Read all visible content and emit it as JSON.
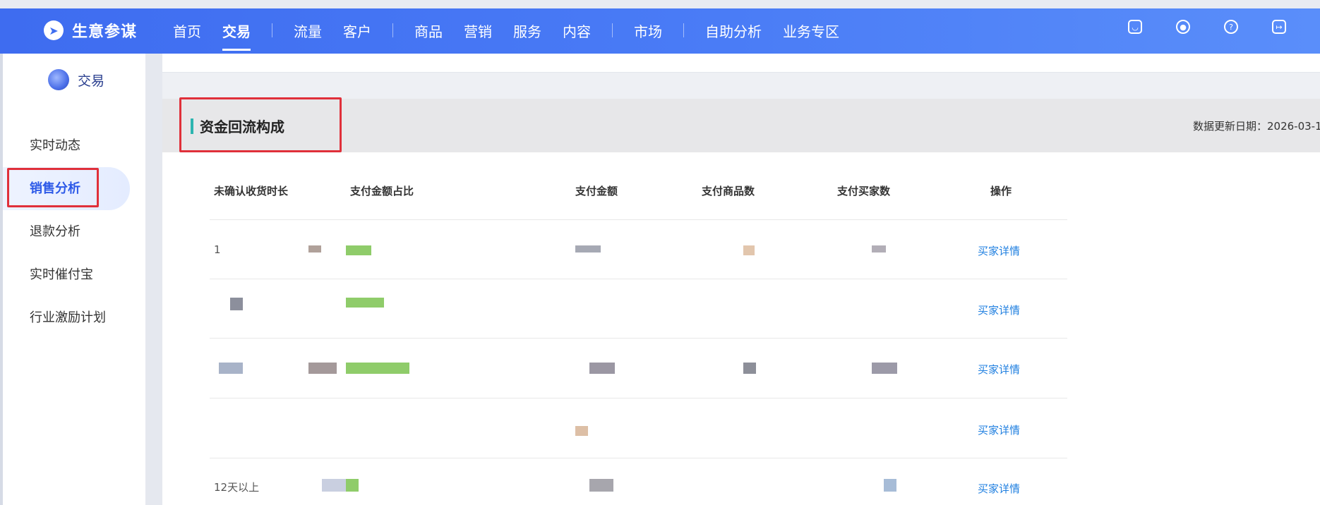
{
  "app": {
    "brand": "生意参谋"
  },
  "nav": {
    "items": [
      "首页",
      "交易",
      "流量",
      "客户",
      "商品",
      "营销",
      "服务",
      "内容",
      "市场",
      "自助分析",
      "业务专区"
    ],
    "active": "交易"
  },
  "top_icons": [
    "message-icon",
    "user-icon",
    "help-icon",
    "logout-icon"
  ],
  "sidebar": {
    "title": "交易",
    "items": [
      {
        "label": "实时动态"
      },
      {
        "label": "销售分析"
      },
      {
        "label": "退款分析"
      },
      {
        "label": "实时催付宝"
      },
      {
        "label": "行业激励计划"
      }
    ],
    "active": "销售分析"
  },
  "section": {
    "title": "资金回流构成",
    "update_label": "数据更新日期：2026-03-1"
  },
  "table": {
    "headers": [
      "未确认收货时长",
      "支付金额占比",
      "支付金额",
      "支付商品数",
      "支付买家数",
      "操作"
    ],
    "rows": [
      {
        "duration": "1",
        "ratio_fill": 0.2,
        "action": "买家详情"
      },
      {
        "duration": "",
        "ratio_fill": 0.3,
        "action": "买家详情"
      },
      {
        "duration": "",
        "ratio_fill": 0.5,
        "action": "买家详情"
      },
      {
        "duration": "",
        "ratio_fill": 0,
        "action": "买家详情"
      },
      {
        "duration": "12天以上",
        "ratio_fill": 0.1,
        "action": "买家详情"
      }
    ]
  },
  "colors": {
    "accent": "#3f6ef0",
    "link": "#1f7fe0",
    "bar": "#8fcc6a",
    "highlight": "#e0303a"
  }
}
